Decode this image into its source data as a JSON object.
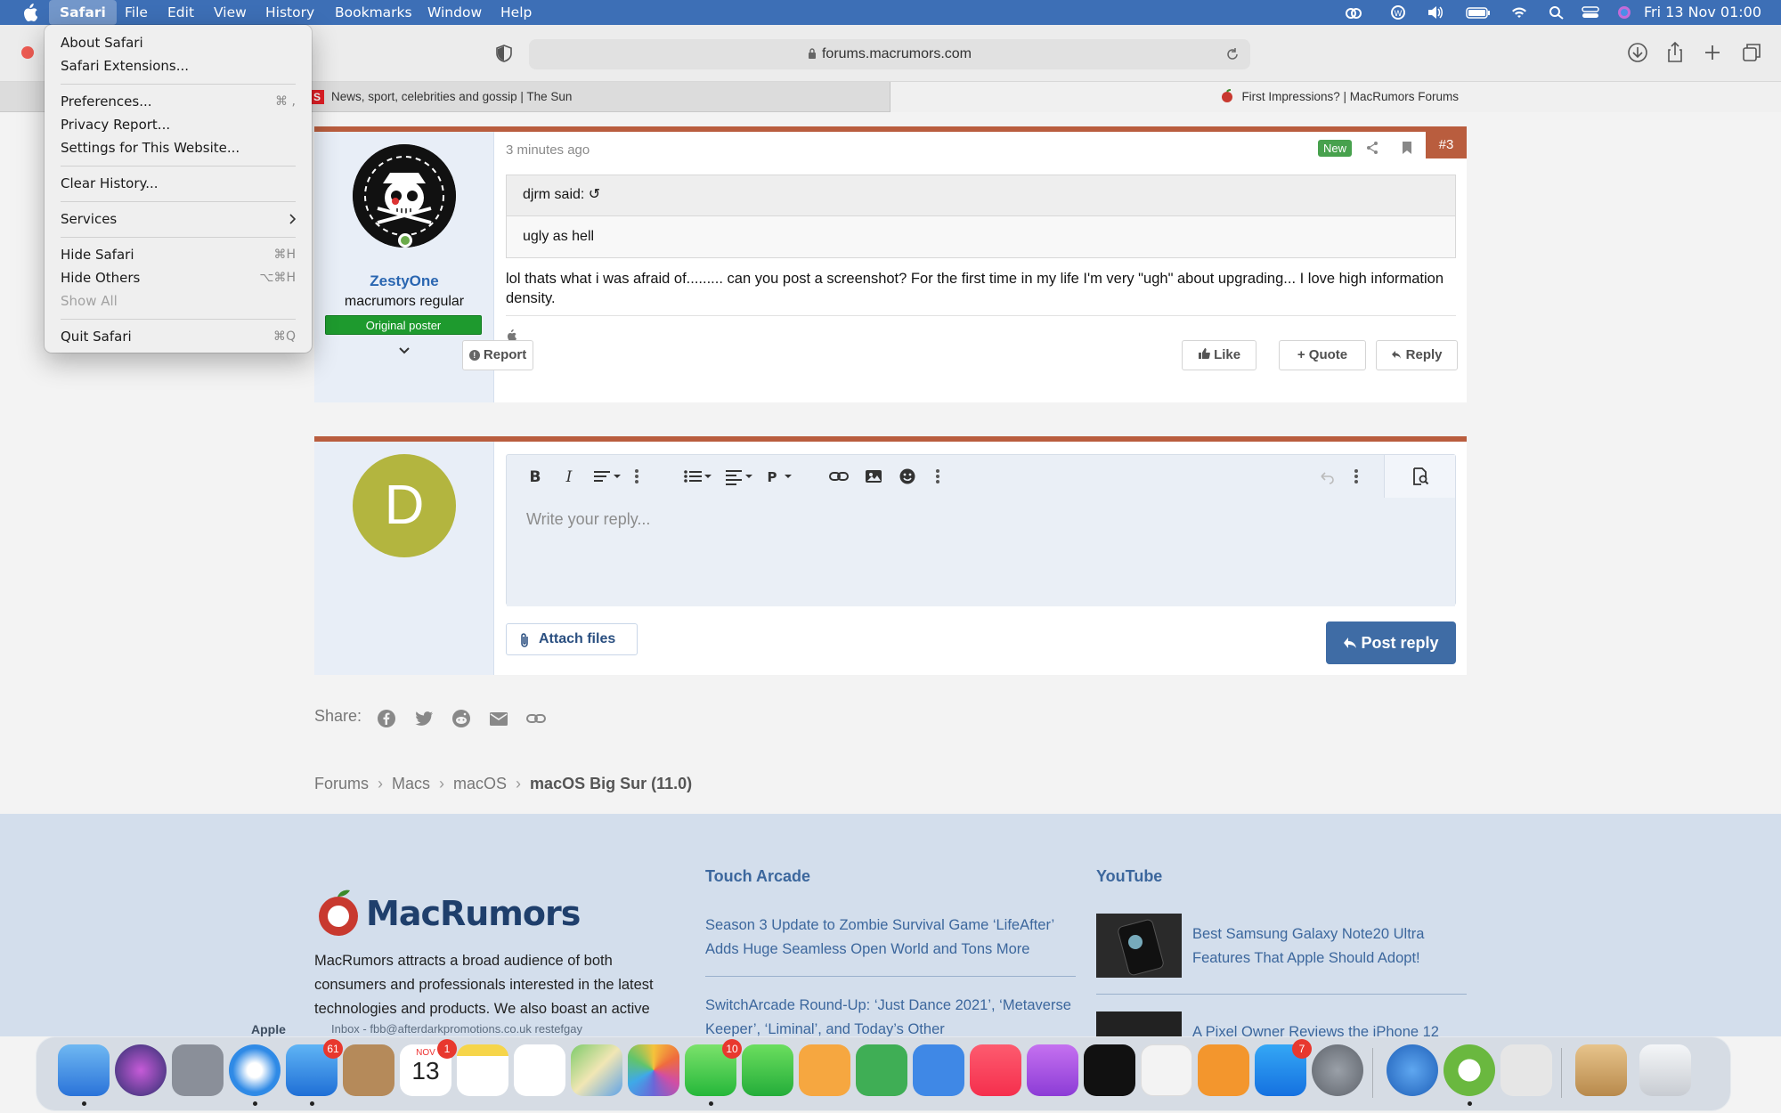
{
  "menubar": {
    "app": "Safari",
    "items": [
      "File",
      "Edit",
      "View",
      "History",
      "Bookmarks",
      "Window",
      "Help"
    ],
    "clock": "Fri 13 Nov  01:00"
  },
  "toolbar": {
    "url": "forums.macrumors.com"
  },
  "tabs": [
    {
      "title": "News, sport, celebrities and gossip | The Sun",
      "favicon_letter": "S"
    },
    {
      "title": "First Impressions? | MacRumors Forums"
    }
  ],
  "safari_menu": {
    "about": "About Safari",
    "extensions": "Safari Extensions...",
    "preferences": "Preferences...",
    "preferences_shortcut": "⌘ ,",
    "privacy": "Privacy Report...",
    "settings_site": "Settings for This Website...",
    "clear_history": "Clear History...",
    "services": "Services",
    "hide_safari": "Hide Safari",
    "hide_safari_shortcut": "⌘H",
    "hide_others": "Hide Others",
    "hide_others_shortcut": "⌥⌘H",
    "show_all": "Show All",
    "quit": "Quit Safari",
    "quit_shortcut": "⌘Q"
  },
  "post": {
    "time": "3 minutes ago",
    "new_badge": "New",
    "number": "#3",
    "username": "ZestyOne",
    "user_title": "macrumors regular",
    "badge": "Original poster",
    "quote_author": "djrm said: ↺",
    "quote_text": "ugly as hell",
    "text": "lol thats what i was afraid of......... can you post a screenshot? For the first time in my life I'm very \"ugh\" about upgrading... I love high information density.",
    "report": "Report",
    "like": "Like",
    "quote": "+ Quote",
    "reply": "Reply"
  },
  "reply_box": {
    "avatar_letter": "D",
    "placeholder": "Write your reply...",
    "attach": "Attach files",
    "post": "Post reply"
  },
  "share": {
    "label": "Share:"
  },
  "breadcrumb": [
    "Forums",
    "Macs",
    "macOS"
  ],
  "breadcrumb_current": "macOS Big Sur (11.0)",
  "footer": {
    "logo": "MacRumors",
    "about": "MacRumors attracts a broad audience of both consumers and professionals interested in the latest technologies and products. We also boast an active",
    "touch_arcade": {
      "heading": "Touch Arcade",
      "link1": "Season 3 Update to Zombie Survival Game ‘LifeAfter’ Adds Huge Seamless Open World and Tons More",
      "link2": "SwitchArcade Round-Up: ‘Just Dance 2021’, ‘Metaverse Keeper’, ‘Liminal’, and Today’s Other"
    },
    "youtube": {
      "heading": "YouTube",
      "link1": "Best Samsung Galaxy Note20 Ultra Features That Apple Should Adopt!",
      "link2": "A Pixel Owner Reviews the iPhone 12"
    },
    "bg_apple": "Apple",
    "bg_mail": "Inbox - fbb@afterdarkpromotions.co.uk   restefgay"
  },
  "dock": {
    "mail_badge": "61",
    "calendar_badge": "1",
    "calendar_month": "NOV",
    "calendar_day": "13",
    "messages_badge": "10",
    "appstore_badge": "7"
  }
}
